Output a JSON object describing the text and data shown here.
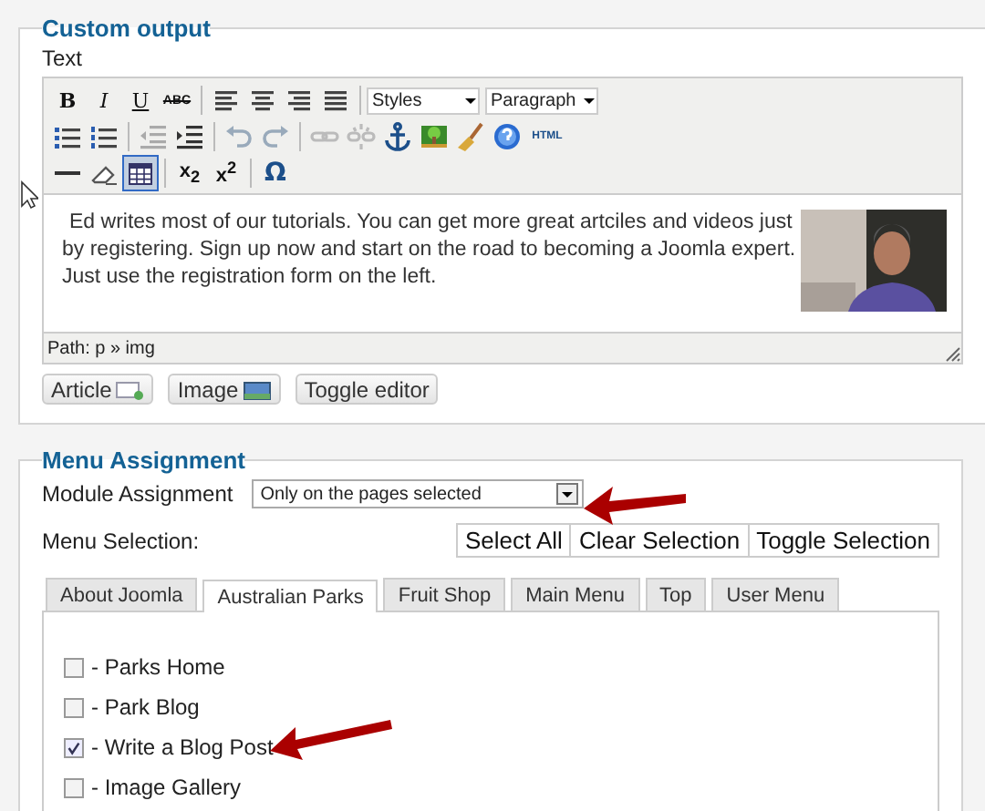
{
  "custom_output": {
    "legend": "Custom output",
    "field_label": "Text",
    "toolbar": {
      "bold": "B",
      "italic": "I",
      "underline": "U",
      "strikethrough": "ABC",
      "styles_select": "Styles",
      "format_select": "Paragraph",
      "html": "HTML",
      "subscript": "x$_{2}$",
      "superscript": "x$^{2}$",
      "special_char": "Ω",
      "table_button": {
        "selected": true
      }
    },
    "content": "Ed writes most of our tutorials. You can get more great artciles and videos just by registering. Sign up now and start on the road to becoming a Joomla expert. Just use the registration form on the left.",
    "content_image": {
      "kind": "picture"
    },
    "path": "Path: p » img",
    "buttons": [
      "Article",
      "Image",
      "Toggle editor"
    ]
  },
  "menu_assignment": {
    "legend": "Menu Assignment",
    "module_assignment": {
      "label": "Module Assignment",
      "value": "Only on the pages selected"
    },
    "menu_selection_label": "Menu Selection:",
    "selection_buttons": [
      "Select All",
      "Clear Selection",
      "Toggle Selection"
    ],
    "tabs": [
      {
        "label": "About Joomla",
        "selected": false
      },
      {
        "label": "Australian Parks",
        "selected": true
      },
      {
        "label": "Fruit Shop",
        "selected": false
      },
      {
        "label": "Main Menu",
        "selected": false
      },
      {
        "label": "Top",
        "selected": false
      },
      {
        "label": "User Menu",
        "selected": false
      }
    ],
    "items": [
      {
        "label": "- Parks Home",
        "checked": false
      },
      {
        "label": "- Park Blog",
        "checked": false
      },
      {
        "label": "- Write a Blog Post",
        "checked": true
      },
      {
        "label": "- Image Gallery",
        "checked": false
      }
    ]
  }
}
